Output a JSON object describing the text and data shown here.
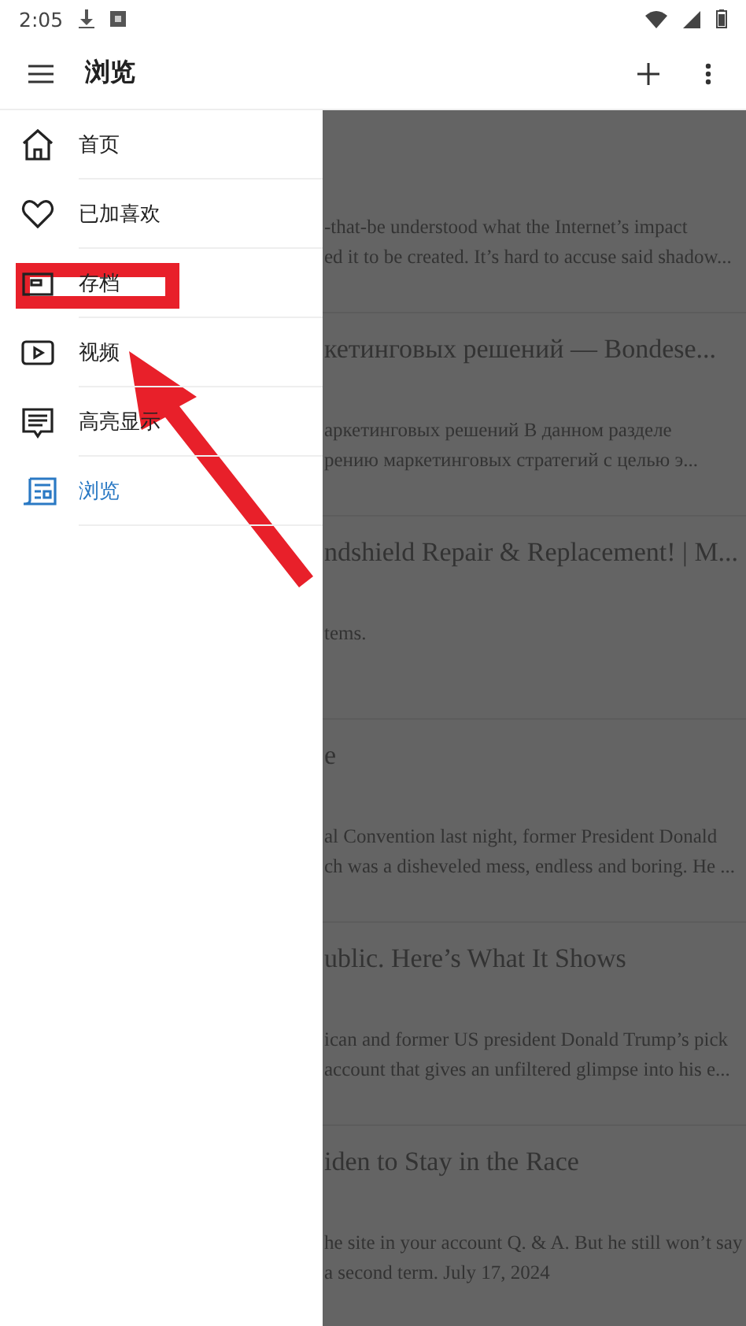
{
  "status_bar": {
    "time": "2:05"
  },
  "app_bar": {
    "title": "浏览"
  },
  "drawer": {
    "items": [
      {
        "kind": "home",
        "label": "首页",
        "selected": false
      },
      {
        "kind": "heart",
        "label": "已加喜欢",
        "selected": false
      },
      {
        "kind": "archive",
        "label": "存档",
        "selected": false
      },
      {
        "kind": "video",
        "label": "视频",
        "selected": false
      },
      {
        "kind": "note",
        "label": "高亮显示",
        "selected": false
      },
      {
        "kind": "browse",
        "label": "浏览",
        "selected": true
      }
    ]
  },
  "articles": [
    {
      "summary": [
        "-that-be understood what the Internet’s impact",
        "ed it to be created. It’s hard to accuse said shadow..."
      ]
    },
    {
      "title": "кетинговых решений — Bondese...",
      "summary": [
        "аркетинговых решений В данном разделе",
        "рению маркетинговых стратегий с целью э..."
      ]
    },
    {
      "title": "ndshield Repair & Replacement! | M...",
      "summary": [
        "tems."
      ]
    },
    {
      "title": "e",
      "summary": [
        "al Convention last night, former President Donald",
        "ch was a disheveled mess, endless and boring. He ..."
      ]
    },
    {
      "title": "ublic. Here’s What It Shows",
      "summary": [
        "ican and former US president Donald Trump’s pick",
        "account that gives an unfiltered glimpse into his e..."
      ]
    },
    {
      "title": "iden to Stay in the Race",
      "summary": [
        "he site in your account Q. & A. But he still won’t say",
        "a second term. July 17, 2024"
      ]
    }
  ]
}
